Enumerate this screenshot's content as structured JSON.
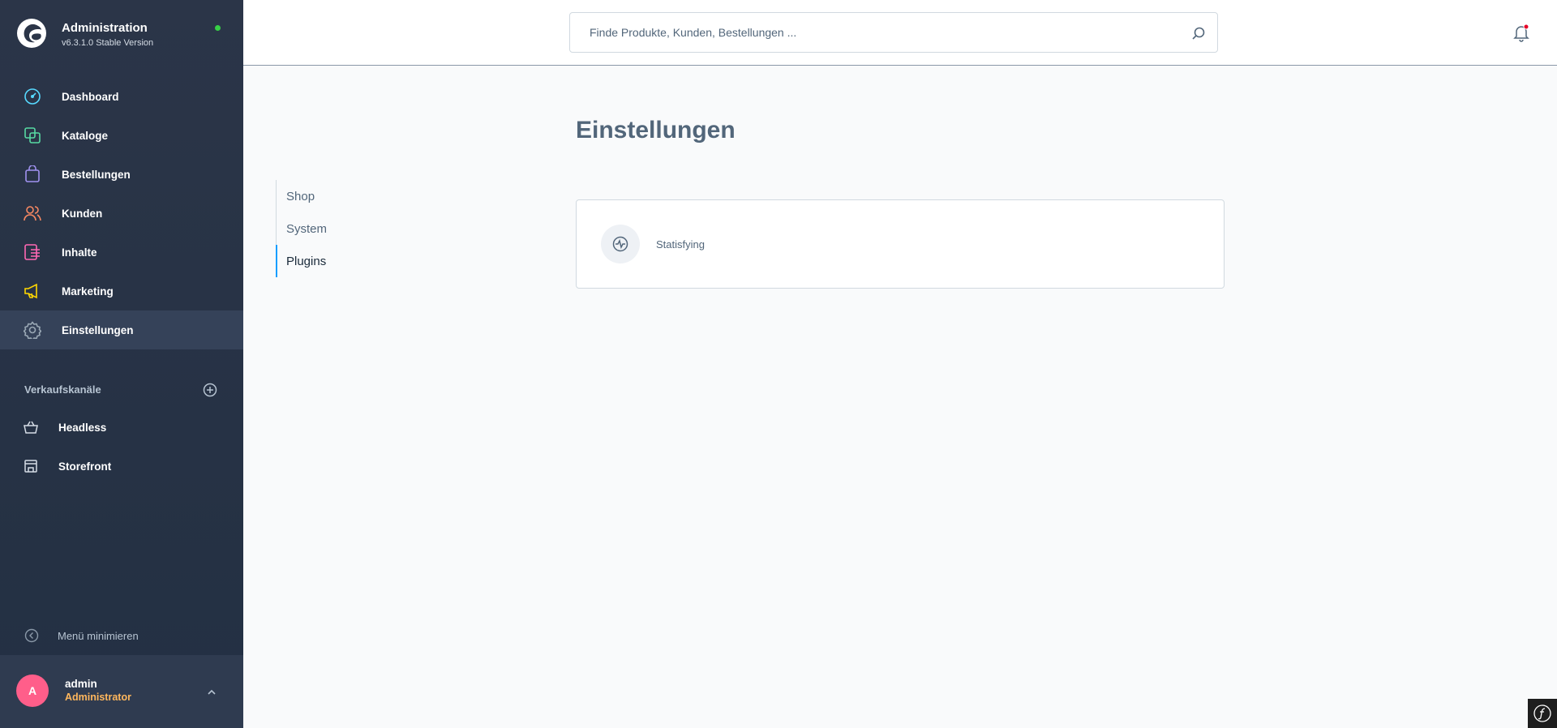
{
  "brand": {
    "title": "Administration",
    "version": "v6.3.1.0 Stable Version"
  },
  "nav": {
    "items": [
      {
        "label": "Dashboard",
        "icon": "dashboard-icon",
        "color": "#57d9ff"
      },
      {
        "label": "Kataloge",
        "icon": "catalog-icon",
        "color": "#57d9a3"
      },
      {
        "label": "Bestellungen",
        "icon": "orders-icon",
        "color": "#a092f0"
      },
      {
        "label": "Kunden",
        "icon": "customers-icon",
        "color": "#f88962"
      },
      {
        "label": "Inhalte",
        "icon": "content-icon",
        "color": "#ff68b4"
      },
      {
        "label": "Marketing",
        "icon": "marketing-icon",
        "color": "#ffd700"
      },
      {
        "label": "Einstellungen",
        "icon": "settings-icon",
        "color": "#9aa8b5"
      }
    ]
  },
  "sales_channels": {
    "label": "Verkaufskanäle",
    "items": [
      {
        "label": "Headless"
      },
      {
        "label": "Storefront"
      }
    ]
  },
  "sidebar_footer": {
    "minimize_label": "Menü minimieren"
  },
  "user": {
    "initial": "A",
    "name": "admin",
    "role": "Administrator"
  },
  "search": {
    "placeholder": "Finde Produkte, Kunden, Bestellungen ..."
  },
  "page": {
    "title": "Einstellungen"
  },
  "settings_tabs": [
    {
      "label": "Shop",
      "active": false
    },
    {
      "label": "System",
      "active": false
    },
    {
      "label": "Plugins",
      "active": true
    }
  ],
  "plugins": [
    {
      "label": "Statisfying",
      "icon": "activity-icon"
    }
  ],
  "colors": {
    "accent": "#189eff",
    "sidebar_bg": "#2b3548",
    "avatar": "#ff5e8a",
    "role": "#ffb75d",
    "online": "#37d046"
  }
}
